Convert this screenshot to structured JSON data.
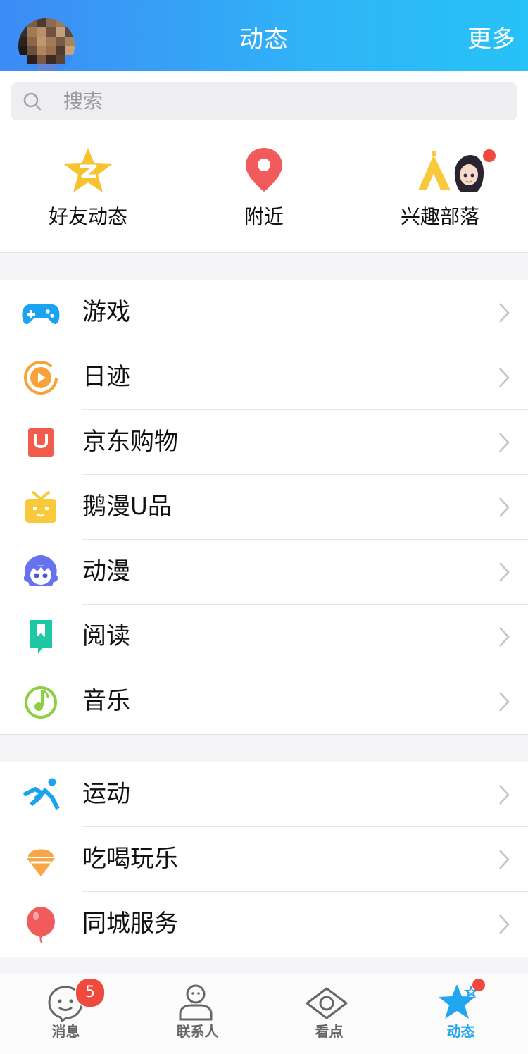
{
  "header": {
    "title": "动态",
    "more": "更多"
  },
  "search": {
    "placeholder": "搜索"
  },
  "quick": [
    {
      "label": "好友动态"
    },
    {
      "label": "附近"
    },
    {
      "label": "兴趣部落"
    }
  ],
  "group1": [
    {
      "label": "游戏"
    },
    {
      "label": "日迹"
    },
    {
      "label": "京东购物"
    },
    {
      "label": "鹅漫U品"
    },
    {
      "label": "动漫"
    },
    {
      "label": "阅读"
    },
    {
      "label": "音乐"
    }
  ],
  "group2": [
    {
      "label": "运动"
    },
    {
      "label": "吃喝玩乐"
    },
    {
      "label": "同城服务"
    }
  ],
  "tabs": [
    {
      "label": "消息",
      "badge": "5"
    },
    {
      "label": "联系人"
    },
    {
      "label": "看点"
    },
    {
      "label": "动态"
    }
  ],
  "colors": {
    "accent": "#23a6f0",
    "badge": "#f04a3e",
    "header_start": "#3d8bf5",
    "header_end": "#27c2f7"
  }
}
